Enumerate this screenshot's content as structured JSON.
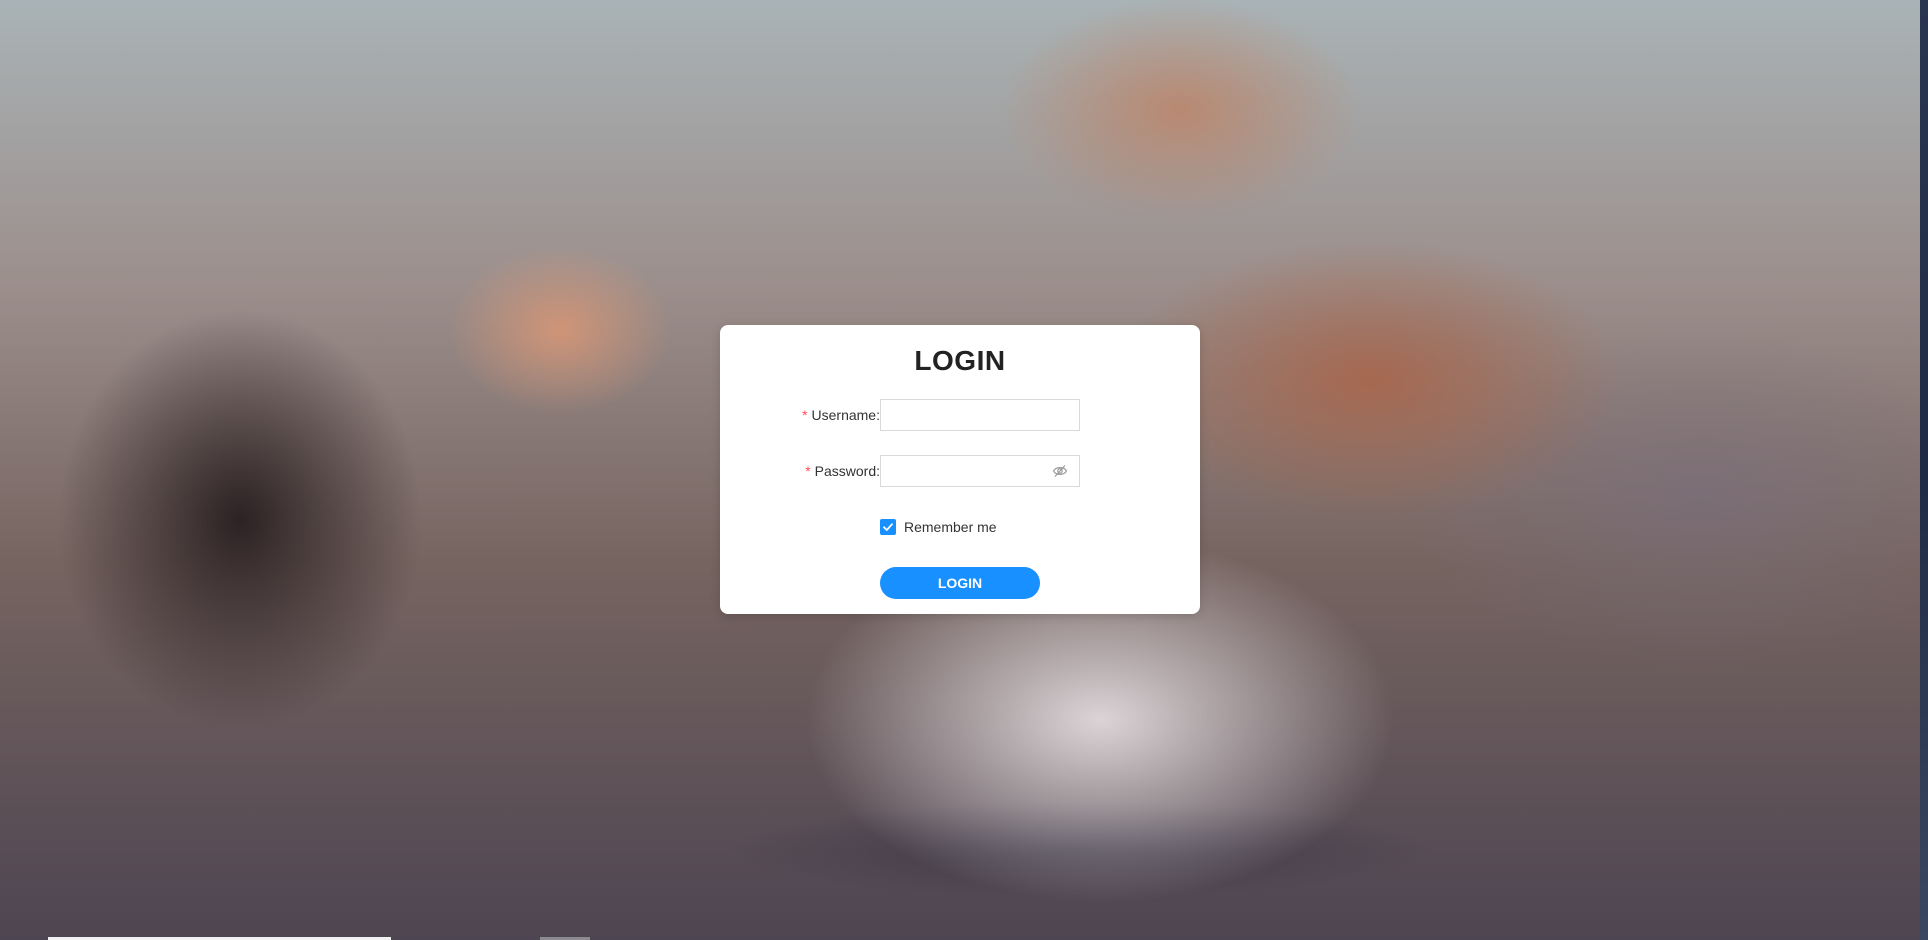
{
  "login_card": {
    "title": "LOGIN",
    "username": {
      "required_mark": "*",
      "label": "Username",
      "colon": ":",
      "value": "",
      "placeholder": ""
    },
    "password": {
      "required_mark": "*",
      "label": "Password",
      "colon": ":",
      "value": "",
      "placeholder": "",
      "toggle_icon": "eye-invisible-icon"
    },
    "remember": {
      "label": "Remember me",
      "checked": true
    },
    "submit_label": "LOGIN"
  },
  "colors": {
    "primary": "#1890ff",
    "required": "#ff4d4f",
    "card_background": "#ffffff"
  }
}
